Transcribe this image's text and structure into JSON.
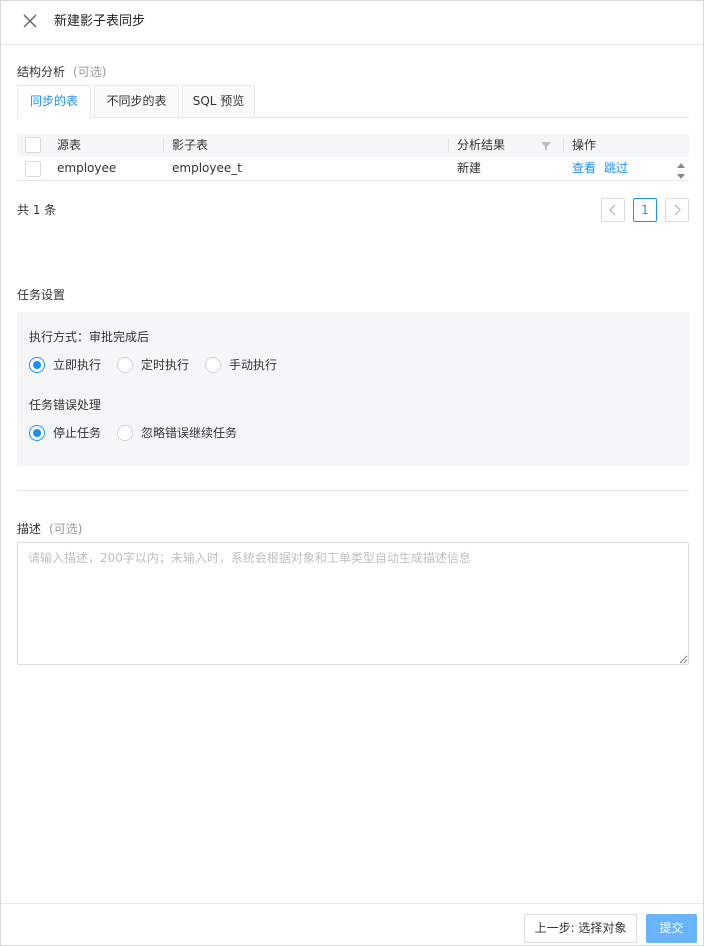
{
  "header": {
    "title": "新建影子表同步"
  },
  "structure": {
    "label": "结构分析",
    "optional": "(可选)",
    "tabs": [
      {
        "label": "同步的表",
        "active": true
      },
      {
        "label": "不同步的表",
        "active": false
      },
      {
        "label": "SQL 预览",
        "active": false
      }
    ],
    "table": {
      "columns": [
        "源表",
        "影子表",
        "分析结果",
        "操作"
      ],
      "rows": [
        {
          "source": "employee",
          "shadow": "employee_t",
          "result": "新建",
          "actions": [
            "查看",
            "跳过"
          ]
        }
      ]
    },
    "total": "共 1 条",
    "pagination": {
      "current": "1"
    }
  },
  "task": {
    "label": "任务设置",
    "exec_label": "执行方式：审批完成后",
    "exec_options": [
      {
        "label": "立即执行",
        "checked": true
      },
      {
        "label": "定时执行",
        "checked": false
      },
      {
        "label": "手动执行",
        "checked": false
      }
    ],
    "error_label": "任务错误处理",
    "error_options": [
      {
        "label": "停止任务",
        "checked": true
      },
      {
        "label": "忽略错误继续任务",
        "checked": false
      }
    ]
  },
  "description": {
    "label": "描述",
    "optional": "(可选)",
    "placeholder": "请输入描述，200字以内；未输入时，系统会根据对象和工单类型自动生成描述信息",
    "value": ""
  },
  "footer": {
    "prev_label": "上一步: 选择对象",
    "submit_label": "提交"
  },
  "colors": {
    "accent": "#1890ff",
    "submit_bg": "#69b4ff",
    "panel_bg": "#f5f6f7"
  }
}
